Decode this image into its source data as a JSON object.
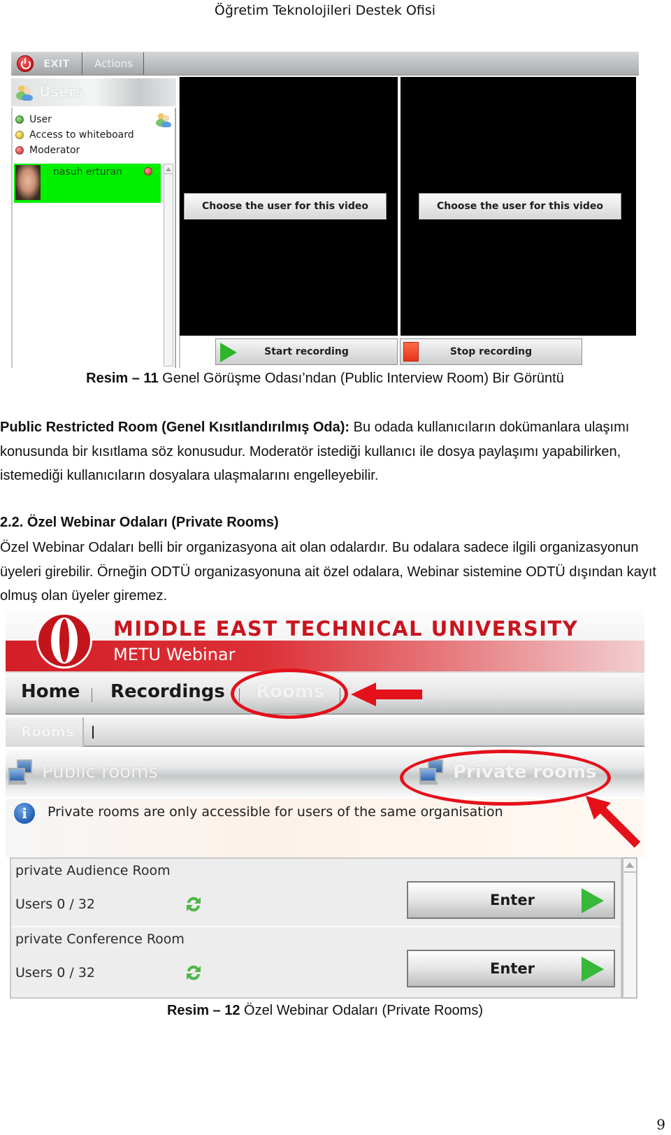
{
  "page_header": "Öğretim Teknolojileri Destek Ofisi",
  "figure11": {
    "toolbar": {
      "exit_label": "EXIT",
      "actions_label": "Actions"
    },
    "users_panel": {
      "title": "Users",
      "legend": [
        {
          "label": "User",
          "color": "green"
        },
        {
          "label": "Access to whiteboard",
          "color": "yellow"
        },
        {
          "label": "Moderator",
          "color": "red"
        }
      ],
      "users": [
        {
          "name": "nasuh erturan",
          "role": "Moderator",
          "highlight": "#00f000"
        }
      ]
    },
    "videos": [
      {
        "choose_label": "Choose the user for this video"
      },
      {
        "choose_label": "Choose the user for this video"
      }
    ],
    "start_recording_label": "Start recording",
    "stop_recording_label": "Stop recording",
    "caption": {
      "label": "Resim – 11",
      "text": " Genel Görüşme Odası’ndan (Public Interview Room) Bir Görüntü"
    }
  },
  "section_restricted": {
    "title": "Public Restricted Room (Genel Kısıtlandırılmış Oda):",
    "body": " Bu odada kullanıcıların dokümanlara ulaşımı konusunda bir kısıtlama söz konusudur. Moderatör istediği kullanıcı ile dosya paylaşımı yapabilirken, istemediği kullanıcıların dosyalara ulaşmalarını engelleyebilir."
  },
  "section_private": {
    "heading": "2.2. Özel Webinar Odaları (Private Rooms)",
    "body": "Özel Webinar Odaları belli bir organizasyona ait olan odalardır. Bu odalara sadece ilgili organizasyonun üyeleri girebilir. Örneğin ODTÜ organizasyonuna ait özel odalara, Webinar sistemine ODTÜ dışından kayıt olmuş olan üyeler giremez."
  },
  "figure12": {
    "university_name": "MIDDLE EAST TECHNICAL UNIVERSITY",
    "app_name": "METU Webinar",
    "nav": [
      {
        "label": "Home",
        "active": false
      },
      {
        "label": "Recordings",
        "active": false
      },
      {
        "label": "Rooms",
        "active": true
      }
    ],
    "subnav": [
      {
        "label": "Rooms",
        "active": true
      }
    ],
    "room_tabs": {
      "public_label": "Public rooms",
      "private_label": "Private rooms",
      "selected": "Private rooms"
    },
    "info_text": "Private rooms are only accessible for users of the same organisation",
    "rooms": [
      {
        "name": "private Audience Room",
        "users": "Users 0 / 32",
        "enter_label": "Enter"
      },
      {
        "name": "private Conference Room",
        "users": "Users 0 / 32",
        "enter_label": "Enter"
      }
    ],
    "annotation_color": "#e4101a",
    "caption": {
      "label": "Resim – 12",
      "text": " Özel Webinar Odaları (Private Rooms)"
    }
  },
  "page_number": "9"
}
